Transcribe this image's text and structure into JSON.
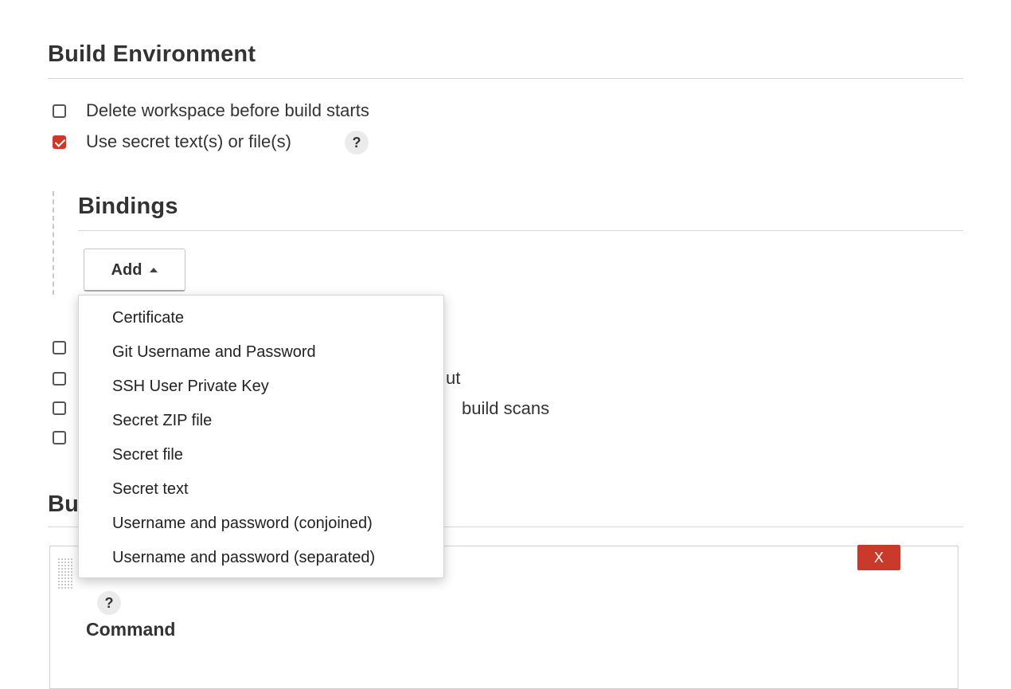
{
  "build_environment": {
    "title": "Build Environment",
    "options": [
      {
        "label": "Delete workspace before build starts",
        "checked": false
      },
      {
        "label": "Use secret text(s) or file(s)",
        "checked": true,
        "help": "?"
      }
    ],
    "hidden_option_fragments": [
      "ut",
      "build scans"
    ]
  },
  "bindings": {
    "title": "Bindings",
    "add_button_label": "Add",
    "menu_items": [
      "Certificate",
      "Git Username and Password",
      "SSH User Private Key",
      "Secret ZIP file",
      "Secret file",
      "Secret text",
      "Username and password (conjoined)",
      "Username and password (separated)"
    ]
  },
  "build": {
    "title_fragment": "Bu",
    "delete_button_label": "X",
    "help": "?",
    "command_label": "Command"
  },
  "colors": {
    "accent": "#c93a2a",
    "text": "#333333",
    "rule": "#d8d8d8"
  }
}
